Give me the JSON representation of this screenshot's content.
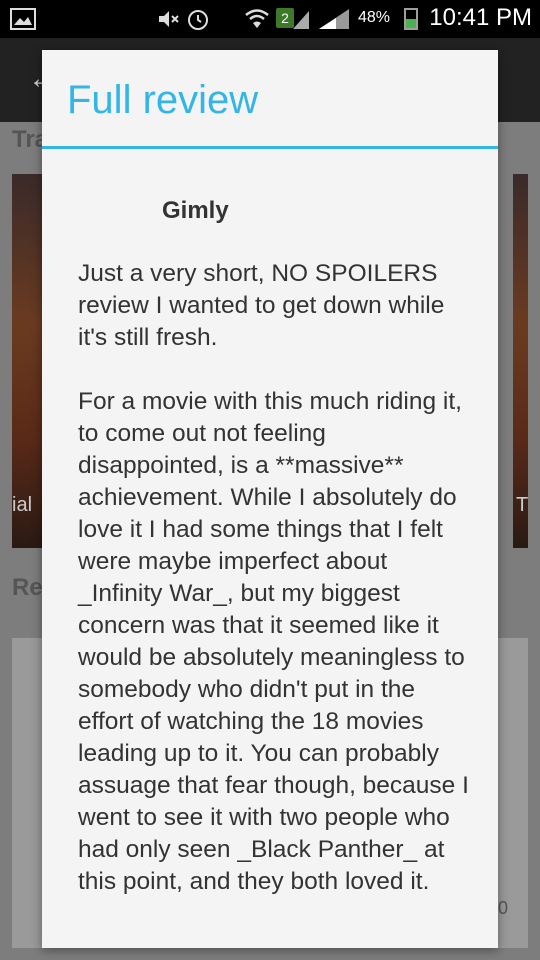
{
  "status_bar": {
    "time": "10:41 PM",
    "battery_percent": "48%",
    "sim_badge": "2",
    "battery_level": 0.48
  },
  "background": {
    "trailers_label": "Tra",
    "reviews_label": "Re",
    "poster_left_caption": "ial",
    "poster_right_caption": "T",
    "card_value": "0"
  },
  "dialog": {
    "title": "Full review",
    "author": "Gimly",
    "paragraphs": [
      "Just a very short, NO SPOILERS review I wanted to get down while it's still fresh.",
      "For a movie with this much riding it, to come out not feeling disappointed, is a **massive** achievement. While I absolutely do love it I had some things that I felt were maybe imperfect about _Infinity War_, but my biggest concern was that it seemed like it would be absolutely meaningless to somebody who didn't put in the effort of watching the 18 movies leading up to it. You can probably assuage that fear though, because I went to see it with two people who had only seen _Black Panther_ at this point, and they both loved it."
    ]
  }
}
